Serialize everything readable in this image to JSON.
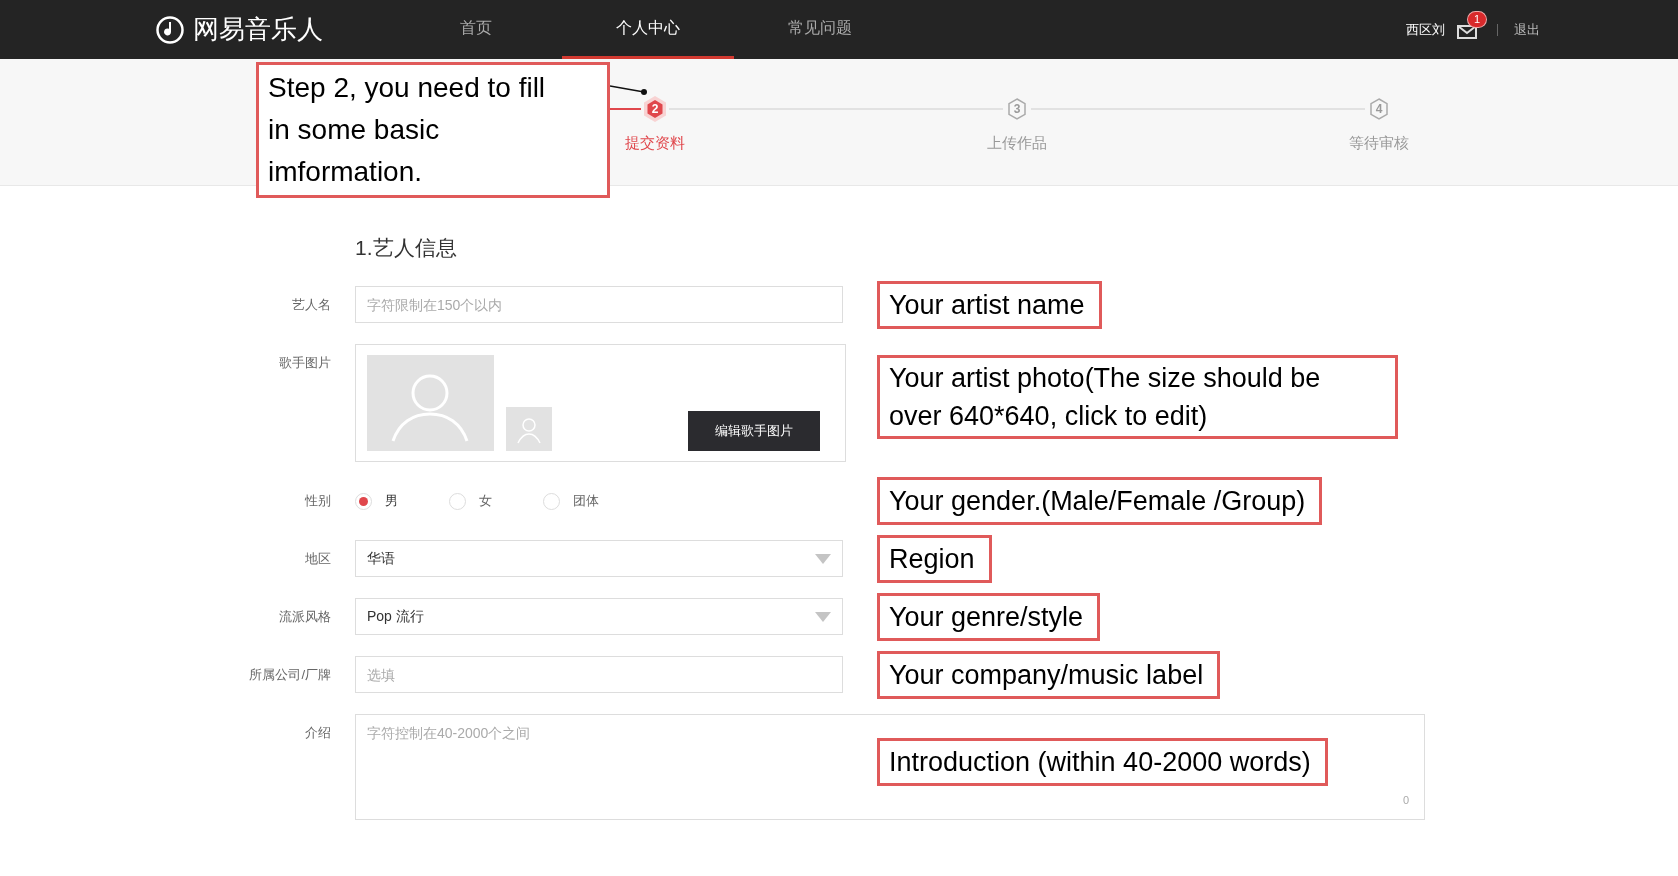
{
  "header": {
    "logo_text": "网易音乐人",
    "nav": [
      {
        "label": "首页",
        "selected": false
      },
      {
        "label": "个人中心",
        "selected": true
      },
      {
        "label": "常见问题",
        "selected": false
      }
    ],
    "user_name": "西区刘",
    "mail_badge": "1",
    "logout": "退出"
  },
  "steps": [
    {
      "number": "2",
      "label": "提交资料",
      "selected": true
    },
    {
      "number": "3",
      "label": "上传作品",
      "selected": false
    },
    {
      "number": "4",
      "label": "等待审核",
      "selected": false
    }
  ],
  "callout": "Step 2, you need to fill in some basic imformation.",
  "form": {
    "title": "1.艺人信息",
    "fields": [
      {
        "kind": "text",
        "label": "艺人名",
        "placeholder": "字符限制在150个以内",
        "note": "Your artist name"
      },
      {
        "kind": "photo",
        "label": "歌手图片",
        "button": "编辑歌手图片",
        "note": "Your artist photo(The size should be over 640*640, click to edit)"
      },
      {
        "kind": "radio",
        "label": "性别",
        "options": [
          {
            "label": "男",
            "selected": true
          },
          {
            "label": "女",
            "selected": false
          },
          {
            "label": "团体",
            "selected": false
          }
        ],
        "note": "Your gender.(Male/Female /Group)"
      },
      {
        "kind": "select",
        "label": "地区",
        "value": "华语",
        "note": "Region"
      },
      {
        "kind": "select",
        "label": "流派风格",
        "value": "Pop 流行",
        "note": "Your genre/style"
      },
      {
        "kind": "text",
        "label": "所属公司/厂牌",
        "placeholder": "选填",
        "note": "Your company/music label"
      },
      {
        "kind": "textarea",
        "label": "介绍",
        "placeholder": "字符控制在40-2000个之间",
        "counter": "0",
        "note": "Introduction (within 40-2000 words)"
      }
    ]
  }
}
